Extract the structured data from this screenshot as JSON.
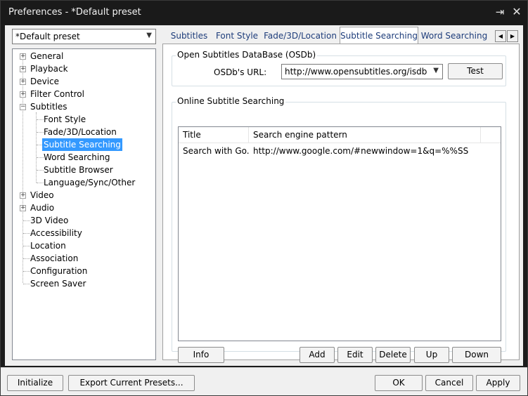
{
  "window": {
    "title": "Preferences - *Default preset",
    "pin_icon": "pin-icon",
    "close_icon": "close-icon"
  },
  "preset": {
    "selected": "*Default preset"
  },
  "tree": {
    "items": [
      {
        "label": "General",
        "expandable": true
      },
      {
        "label": "Playback",
        "expandable": true
      },
      {
        "label": "Device",
        "expandable": true
      },
      {
        "label": "Filter Control",
        "expandable": true
      },
      {
        "label": "Subtitles",
        "expandable": true,
        "expanded": true,
        "children": [
          "Font Style",
          "Fade/3D/Location",
          "Subtitle Searching",
          "Word Searching",
          "Subtitle Browser",
          "Language/Sync/Other"
        ]
      },
      {
        "label": "Video",
        "expandable": true
      },
      {
        "label": "Audio",
        "expandable": true
      },
      {
        "label": "3D Video",
        "expandable": false
      },
      {
        "label": "Accessibility",
        "expandable": false
      },
      {
        "label": "Location",
        "expandable": false
      },
      {
        "label": "Association",
        "expandable": false
      },
      {
        "label": "Configuration",
        "expandable": false
      },
      {
        "label": "Screen Saver",
        "expandable": false
      }
    ],
    "selected": "Subtitle Searching"
  },
  "tabs": [
    {
      "label": "Subtitles"
    },
    {
      "label": "Font Style"
    },
    {
      "label": "Fade/3D/Location"
    },
    {
      "label": "Subtitle Searching",
      "active": true
    },
    {
      "label": "Word Searching"
    }
  ],
  "osdb": {
    "group_label": "Open Subtitles DataBase (OSDb)",
    "url_label": "OSDb's URL:",
    "url_value": "http://www.opensubtitles.org/isdb",
    "test_label": "Test"
  },
  "online": {
    "group_label": "Online Subtitle Searching",
    "columns": [
      "Title",
      "Search engine pattern"
    ],
    "rows": [
      {
        "title": "Search with Go...",
        "pattern": "http://www.google.com/#newwindow=1&q=%%SS"
      }
    ],
    "buttons": {
      "info": "Info",
      "add": "Add",
      "edit": "Edit",
      "delete": "Delete",
      "up": "Up",
      "down": "Down"
    }
  },
  "footer": {
    "initialize": "Initialize",
    "export": "Export Current Presets...",
    "ok": "OK",
    "cancel": "Cancel",
    "apply": "Apply"
  }
}
